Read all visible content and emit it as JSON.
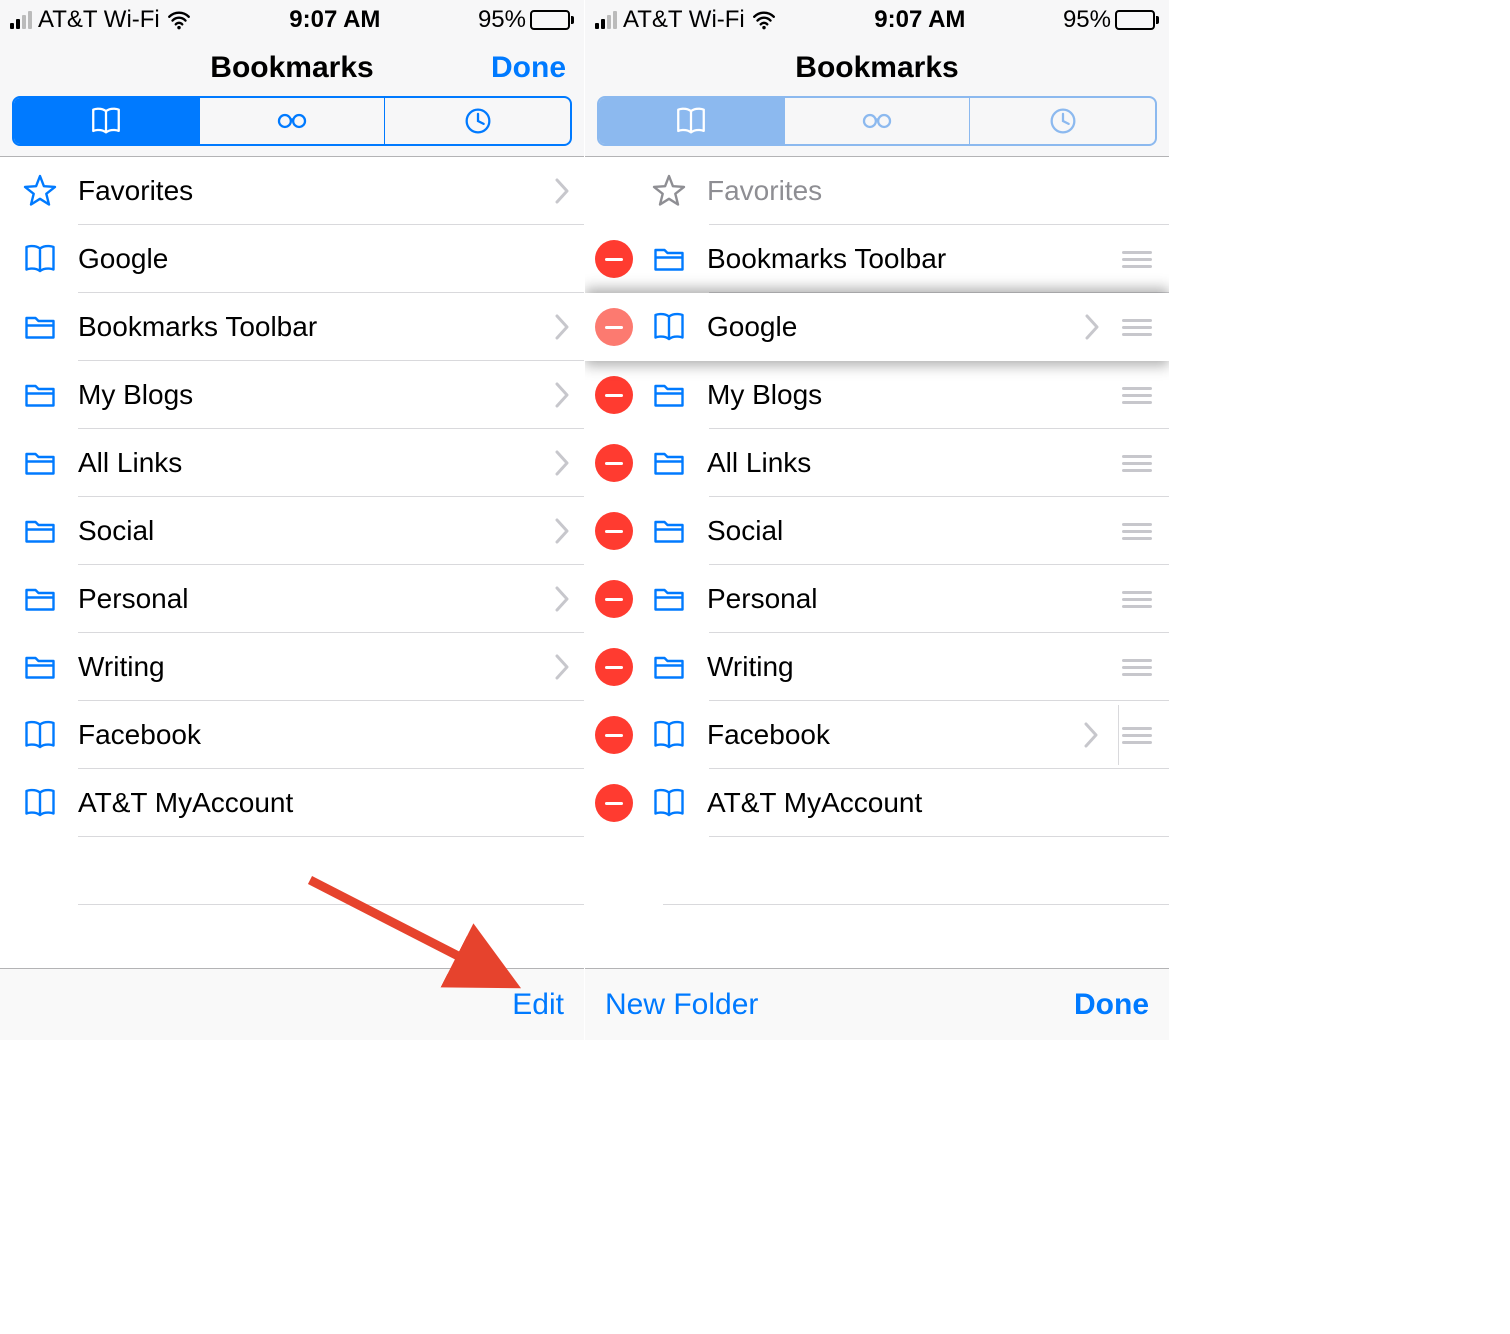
{
  "statusbar": {
    "carrier": "AT&T Wi-Fi",
    "time": "9:07 AM",
    "battery_pct": "95%"
  },
  "left": {
    "title": "Bookmarks",
    "done": "Done",
    "toolbar": {
      "edit": "Edit"
    },
    "rows": [
      {
        "label": "Favorites"
      },
      {
        "label": "Google"
      },
      {
        "label": "Bookmarks Toolbar"
      },
      {
        "label": "My Blogs"
      },
      {
        "label": "All Links"
      },
      {
        "label": "Social"
      },
      {
        "label": "Personal"
      },
      {
        "label": "Writing"
      },
      {
        "label": "Facebook"
      },
      {
        "label": "AT&T MyAccount"
      }
    ]
  },
  "right": {
    "title": "Bookmarks",
    "toolbar": {
      "newfolder": "New Folder",
      "done": "Done"
    },
    "rows": [
      {
        "label": "Favorites"
      },
      {
        "label": "Bookmarks Toolbar"
      },
      {
        "label": "Google"
      },
      {
        "label": "My Blogs"
      },
      {
        "label": "All Links"
      },
      {
        "label": "Social"
      },
      {
        "label": "Personal"
      },
      {
        "label": "Writing"
      },
      {
        "label": "Facebook"
      },
      {
        "label": "AT&T MyAccount"
      }
    ]
  }
}
